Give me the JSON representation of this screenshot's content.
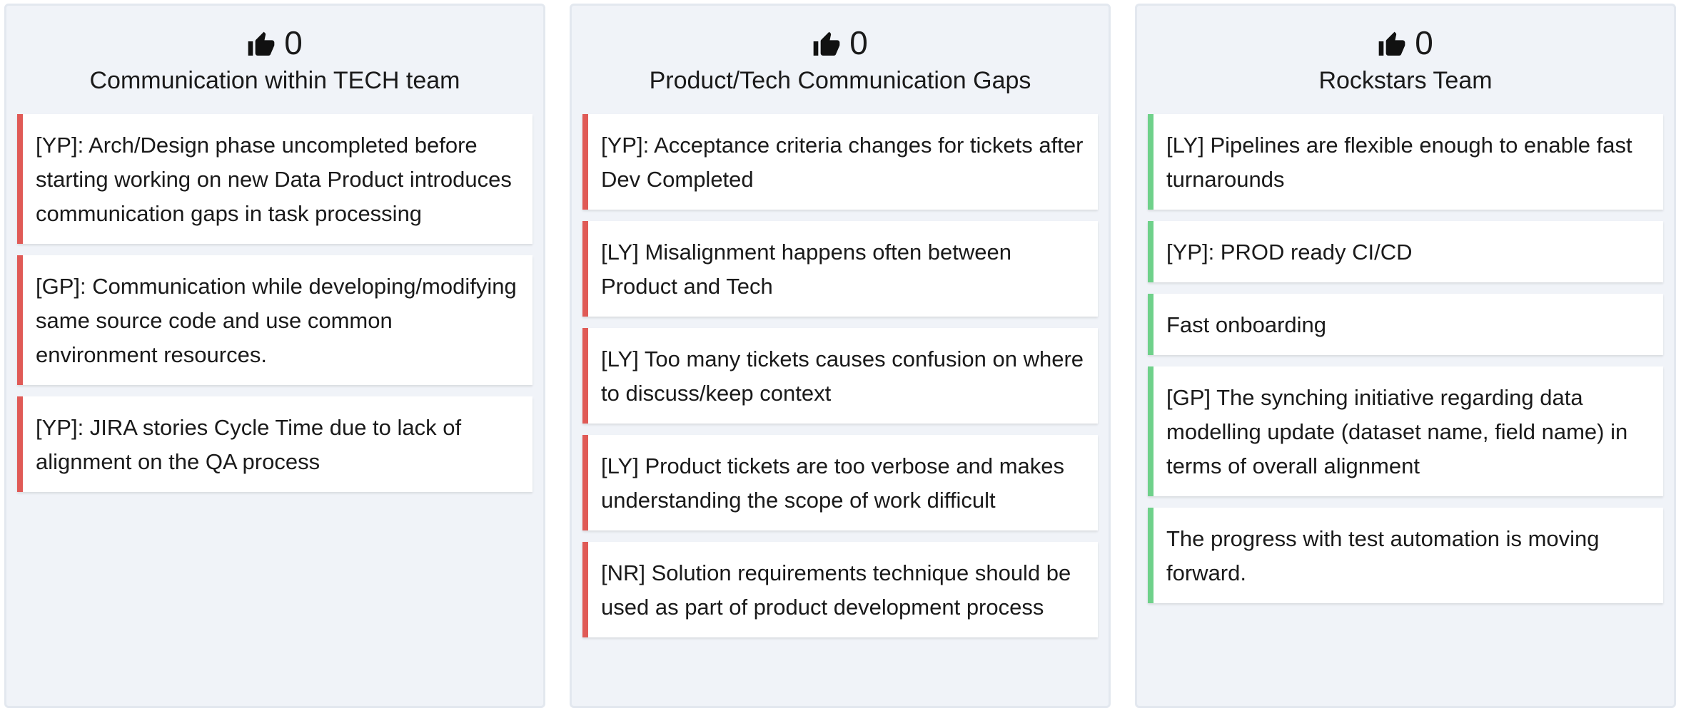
{
  "columns": [
    {
      "votes": "0",
      "title": "Communication within TECH team",
      "cards": [
        "[YP]: Arch/Design phase uncompleted before starting working on new Data Product introduces communication gaps in task processing",
        "[GP]: Communication while developing/modifying same source code and use common environment resources.",
        "[YP]: JIRA stories Cycle Time due to lack of alignment on the QA process"
      ]
    },
    {
      "votes": "0",
      "title": "Product/Tech Communication Gaps",
      "cards": [
        "[YP]: Acceptance criteria changes for tickets after Dev Completed",
        "[LY] Misalignment happens often between Product and Tech",
        "[LY] Too many tickets causes confusion on where to discuss/keep context",
        "[LY] Product tickets are too verbose and makes understanding the scope of work difficult",
        "[NR] Solution requirements technique should be used as part of product development process"
      ]
    },
    {
      "votes": "0",
      "title": "Rockstars Team",
      "cards": [
        "[LY] Pipelines are flexible enough to enable fast turnarounds",
        "[YP]: PROD ready CI/CD",
        "Fast onboarding",
        "[GP] The synching initiative regarding data modelling update (dataset name, field name) in terms of overall alignment",
        "The progress with test automation is moving forward."
      ]
    }
  ],
  "colors": {
    "negative_accent": "#e05a56",
    "positive_accent": "#6fd18a",
    "column_bg": "#f0f3f8"
  },
  "icons": {
    "vote": "thumbs-up-icon"
  }
}
